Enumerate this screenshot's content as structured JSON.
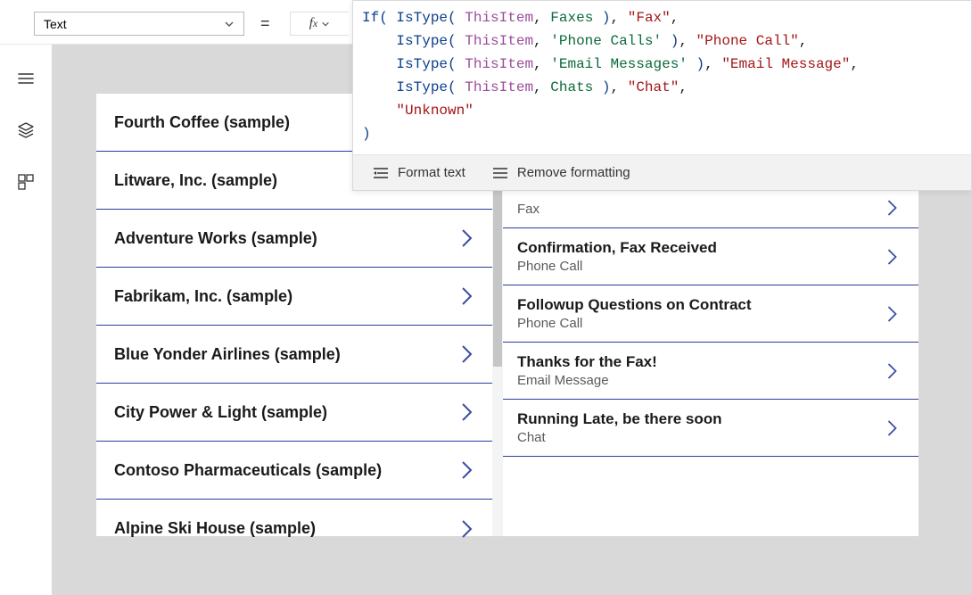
{
  "property_selector": {
    "value": "Text"
  },
  "formula": {
    "tokens": {
      "if": "If",
      "istype": "IsType",
      "thisitem": "ThisItem",
      "faxes": "Faxes",
      "fax_str": "\"Fax\"",
      "phonecalls": "'Phone Calls'",
      "phonecall_str": "\"Phone Call\"",
      "emailmsgs": "'Email Messages'",
      "emailmsg_str": "\"Email Message\"",
      "chats": "Chats",
      "chat_str": "\"Chat\"",
      "unknown_str": "\"Unknown\""
    },
    "toolbar": {
      "format": "Format text",
      "remove": "Remove formatting"
    }
  },
  "left_items": [
    {
      "label": "Fourth Coffee (sample)"
    },
    {
      "label": "Litware, Inc. (sample)"
    },
    {
      "label": "Adventure Works (sample)"
    },
    {
      "label": "Fabrikam, Inc. (sample)"
    },
    {
      "label": "Blue Yonder Airlines (sample)"
    },
    {
      "label": "City Power & Light (sample)"
    },
    {
      "label": "Contoso Pharmaceuticals (sample)"
    },
    {
      "label": "Alpine Ski House (sample)"
    }
  ],
  "right_items": [
    {
      "title": "",
      "sub": "Fax",
      "partial": true
    },
    {
      "title": "Confirmation, Fax Received",
      "sub": "Phone Call"
    },
    {
      "title": "Followup Questions on Contract",
      "sub": "Phone Call"
    },
    {
      "title": "Thanks for the Fax!",
      "sub": "Email Message"
    },
    {
      "title": "Running Late, be there soon",
      "sub": "Chat"
    }
  ]
}
